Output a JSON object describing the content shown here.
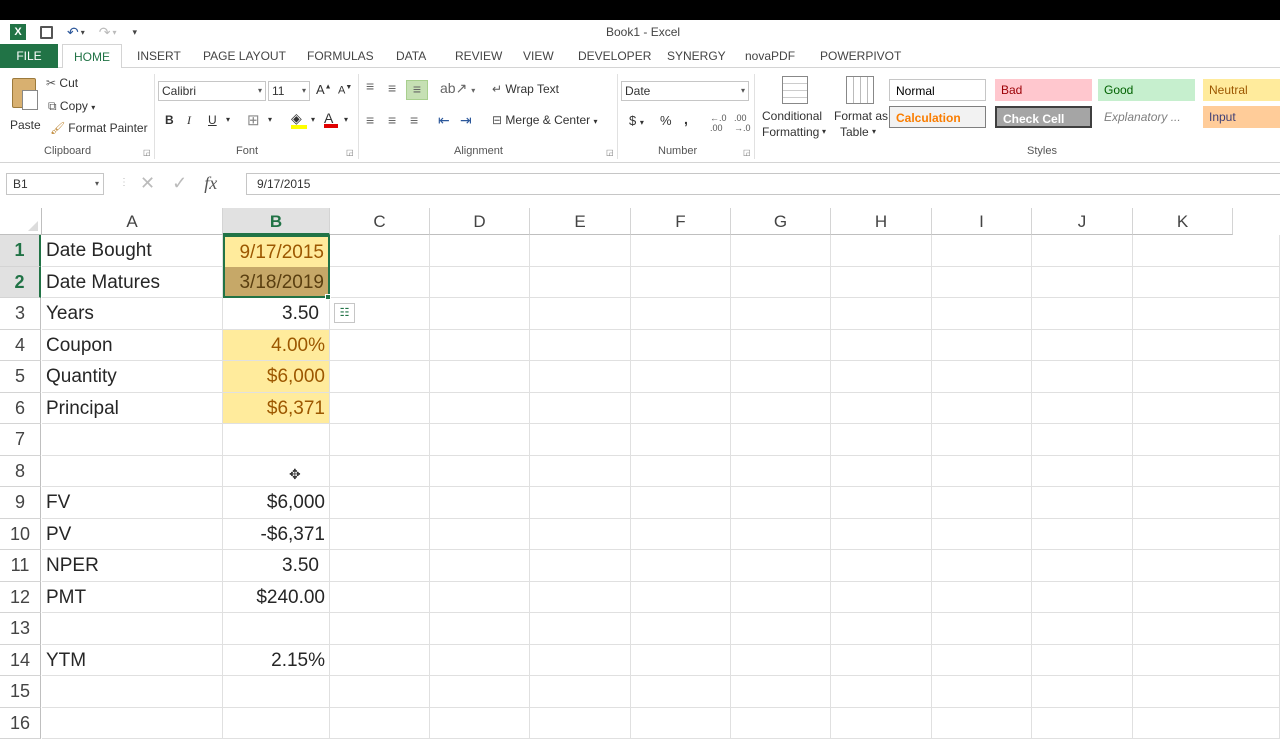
{
  "window": {
    "title": "Book1 - Excel"
  },
  "tabs": [
    "FILE",
    "HOME",
    "INSERT",
    "PAGE LAYOUT",
    "FORMULAS",
    "DATA",
    "REVIEW",
    "VIEW",
    "DEVELOPER",
    "SYNERGY",
    "novaPDF",
    "POWERPIVOT"
  ],
  "clipboard": {
    "paste": "Paste",
    "cut": "Cut",
    "copy": "Copy",
    "format_painter": "Format Painter",
    "group": "Clipboard"
  },
  "font": {
    "name": "Calibri",
    "size": "11",
    "bold": "B",
    "italic": "I",
    "underline": "U",
    "group": "Font"
  },
  "alignment": {
    "wrap_text": "Wrap Text",
    "merge_center": "Merge & Center",
    "group": "Alignment"
  },
  "number": {
    "format": "Date",
    "currency": "$",
    "percent": "%",
    "comma": ",",
    "group": "Number"
  },
  "styles_group": {
    "conditional_1": "Conditional",
    "conditional_2": "Formatting",
    "format_table_1": "Format as",
    "format_table_2": "Table",
    "group": "Styles"
  },
  "styles": [
    {
      "label": "Normal",
      "bg": "#ffffff",
      "fg": "#000000"
    },
    {
      "label": "Bad",
      "bg": "#ffc7ce",
      "fg": "#9c0006"
    },
    {
      "label": "Good",
      "bg": "#c6efce",
      "fg": "#006100"
    },
    {
      "label": "Neutral",
      "bg": "#ffeb9c",
      "fg": "#9c5700"
    },
    {
      "label": "Calculation",
      "bg": "#f2f2f2",
      "fg": "#fa7d00"
    },
    {
      "label": "Check Cell",
      "bg": "#a5a5a5",
      "fg": "#ffffff"
    },
    {
      "label": "Explanatory ...",
      "bg": "#ffffff",
      "fg": "#7f7f7f"
    },
    {
      "label": "Input",
      "bg": "#ffcc99",
      "fg": "#3f3f76"
    }
  ],
  "formula_bar": {
    "name_box": "B1",
    "fx": "fx",
    "value": "9/17/2015"
  },
  "columns": [
    "A",
    "B",
    "C",
    "D",
    "E",
    "F",
    "G",
    "H",
    "I",
    "J",
    "K"
  ],
  "rows": [
    {
      "n": "1",
      "a": "Date Bought",
      "b": "9/17/2015"
    },
    {
      "n": "2",
      "a": "Date Matures",
      "b": "3/18/2019"
    },
    {
      "n": "3",
      "a": "Years",
      "b": "3.50"
    },
    {
      "n": "4",
      "a": "Coupon",
      "b": "4.00%"
    },
    {
      "n": "5",
      "a": "Quantity",
      "b": "$6,000"
    },
    {
      "n": "6",
      "a": "Principal",
      "b": "$6,371"
    },
    {
      "n": "7",
      "a": "",
      "b": ""
    },
    {
      "n": "8",
      "a": "",
      "b": ""
    },
    {
      "n": "9",
      "a": "FV",
      "b": "$6,000"
    },
    {
      "n": "10",
      "a": "PV",
      "b": "-$6,371"
    },
    {
      "n": "11",
      "a": "NPER",
      "b": "3.50"
    },
    {
      "n": "12",
      "a": "PMT",
      "b": "$240.00"
    },
    {
      "n": "13",
      "a": "",
      "b": ""
    },
    {
      "n": "14",
      "a": "YTM",
      "b": "2.15%"
    },
    {
      "n": "15",
      "a": "",
      "b": ""
    },
    {
      "n": "16",
      "a": "",
      "b": ""
    }
  ],
  "colors": {
    "accent": "#217346",
    "input_fill": "#ffeb9c",
    "input_text": "#9c5700",
    "selected_fill": "#c6a868"
  }
}
